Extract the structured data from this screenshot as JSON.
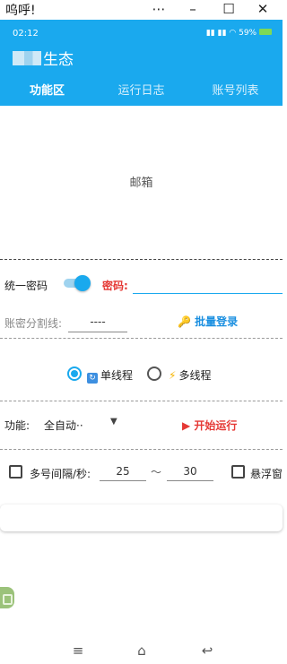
{
  "window": {
    "title": "呜呼!",
    "menu_icon": "⋯",
    "minimize_icon": "–",
    "maximize_icon": "☐",
    "close_icon": "✕"
  },
  "status": {
    "time": "02:12",
    "battery": "59%"
  },
  "app": {
    "title": "生态"
  },
  "tabs": [
    "功能区",
    "运行日志",
    "账号列表"
  ],
  "email": {
    "label": "邮箱"
  },
  "password_row": {
    "unified_label": "统一密码",
    "toggle_on": true,
    "password_label": "密码:",
    "password_value": ""
  },
  "separator_row": {
    "label": "账密分割线:",
    "value": "----",
    "batch_login": "批量登录"
  },
  "thread_row": {
    "single": "单线程",
    "multi": "多线程",
    "selected": "single"
  },
  "function_row": {
    "label": "功能:",
    "value": "全自动··",
    "start": "开始运行"
  },
  "interval_row": {
    "label": "多号间隔/秒:",
    "min": "25",
    "tilde": "～",
    "max": "30",
    "float_window": "悬浮窗"
  },
  "colors": {
    "accent": "#1aa9ee",
    "danger": "#e53935",
    "link": "#1a8fe0"
  }
}
